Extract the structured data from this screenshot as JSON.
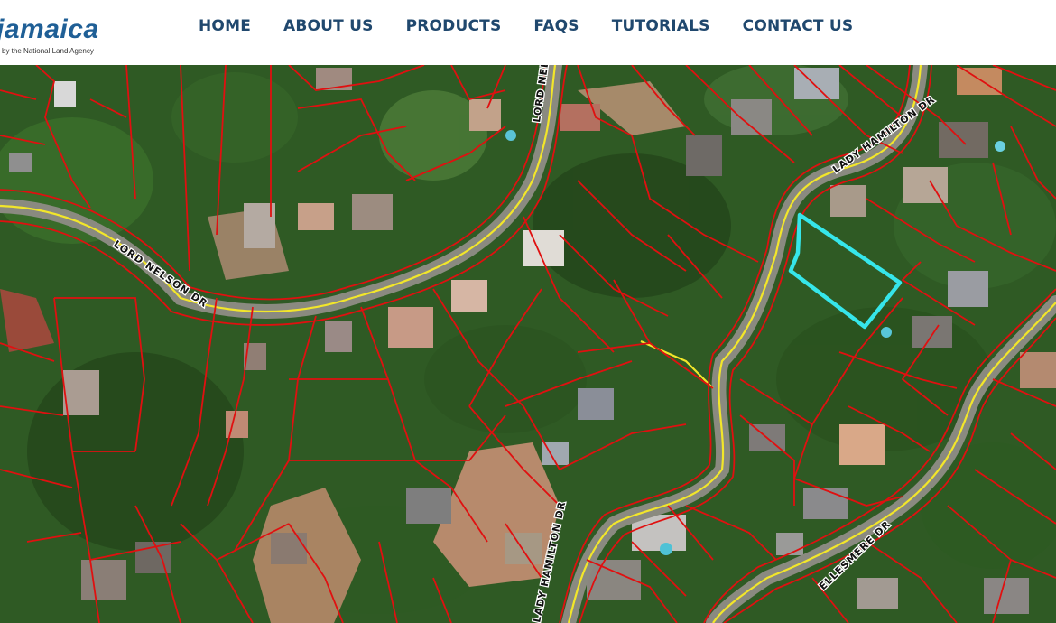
{
  "brand": {
    "name": "jamaica",
    "tagline": "by the National Land Agency",
    "color": "#1f5f96"
  },
  "nav": {
    "items": [
      "HOME",
      "ABOUT US",
      "PRODUCTS",
      "FAQS",
      "TUTORIALS",
      "CONTACT US"
    ],
    "color": "#20486e"
  },
  "map": {
    "road_labels": [
      "LORD NELSON DR",
      "LORD NEL",
      "LADY HAMILTON DR",
      "LADY HAMILTON DR",
      "ELLESMERE DR"
    ],
    "colors": {
      "parcel_line": "#e01010",
      "road_line": "#f2e62a",
      "selected_parcel": "#36e6ea",
      "vegetation": "#2f5a24"
    }
  }
}
